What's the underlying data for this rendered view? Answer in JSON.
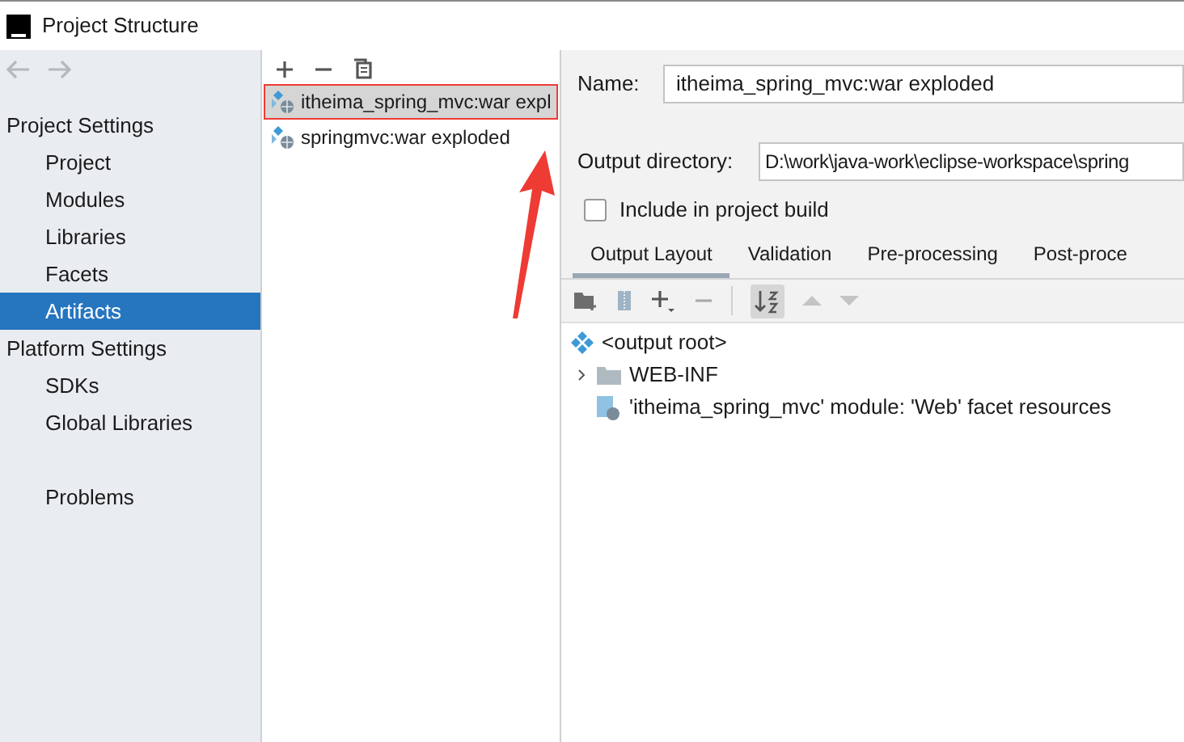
{
  "window": {
    "title": "Project Structure"
  },
  "sidebar": {
    "groups": [
      {
        "heading": "Project Settings",
        "items": [
          {
            "label": "Project",
            "selected": false
          },
          {
            "label": "Modules",
            "selected": false
          },
          {
            "label": "Libraries",
            "selected": false
          },
          {
            "label": "Facets",
            "selected": false
          },
          {
            "label": "Artifacts",
            "selected": true
          }
        ]
      },
      {
        "heading": "Platform Settings",
        "items": [
          {
            "label": "SDKs",
            "selected": false
          },
          {
            "label": "Global Libraries",
            "selected": false
          }
        ]
      },
      {
        "items": [
          {
            "label": "Problems",
            "selected": false
          }
        ]
      }
    ]
  },
  "artifacts": [
    {
      "label": "itheima_spring_mvc:war expl",
      "selected": true,
      "annotated": true
    },
    {
      "label": "springmvc:war exploded",
      "selected": false,
      "annotated": false
    }
  ],
  "details": {
    "name_label": "Name:",
    "name_value": "itheima_spring_mvc:war exploded",
    "output_label": "Output directory:",
    "output_value": "D:\\work\\java-work\\eclipse-workspace\\spring",
    "include_label": "Include in project build",
    "include_checked": false,
    "tabs": [
      {
        "label": "Output Layout",
        "selected": true
      },
      {
        "label": "Validation",
        "selected": false
      },
      {
        "label": "Pre-processing",
        "selected": false
      },
      {
        "label": "Post-proce",
        "selected": false
      }
    ],
    "tree": [
      {
        "kind": "root",
        "label": "<output root>",
        "children": [
          {
            "kind": "folder",
            "label": "WEB-INF",
            "expanded": false
          },
          {
            "kind": "resource",
            "label": "'itheima_spring_mvc' module: 'Web' facet resources"
          }
        ]
      }
    ]
  }
}
